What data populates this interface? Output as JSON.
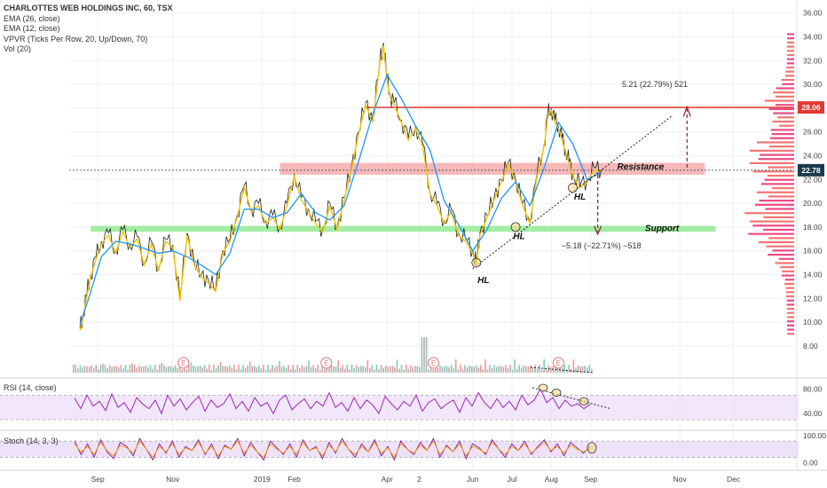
{
  "header": {
    "title": "CHARLOTTES WEB HOLDINGS INC, 60, TSX",
    "indicators": [
      "EMA (26, close)",
      "EMA (12, close)",
      "VPVR (Ticks Per Row, 20, Up/Down, 70)",
      "Vol (20)"
    ]
  },
  "rsi_label": "RSI (14, close)",
  "stoch_label": "Stoch (14, 3, 3)",
  "colors": {
    "price": "#222222",
    "ema_fast": "#f2c400",
    "ema_slow": "#2196f3",
    "resistance_zone": "#f4a7a7",
    "support_zone": "#8fe88f",
    "resistance_line": "#e53935",
    "rsi": "#9c27b0",
    "stoch_k": "#7b1fa2",
    "stoch_d": "#ff9800",
    "panel_band": "#e7d6f7",
    "last_price_bg": "#1b3a4b",
    "resistance_price_bg": "#e53935"
  },
  "chart_data": [
    {
      "type": "line",
      "y_axis_ticks": [
        8,
        10,
        12,
        14,
        16,
        18,
        20,
        22,
        24,
        26,
        28,
        30,
        32,
        34,
        36
      ],
      "y_axis_labels": [
        "8.00",
        "10.00",
        "12.00",
        "14.00",
        "16.00",
        "18.00",
        "20.00",
        "22.00",
        "24.00",
        "26.00",
        "28.00",
        "30.00",
        "32.00",
        "34.00",
        "36.00"
      ],
      "ylim": [
        6.5,
        36.5
      ],
      "x_tick_labels": [
        "Sep",
        "Nov",
        "2019",
        "Feb",
        "Apr",
        "2",
        "Jun",
        "Jul",
        "Aug",
        "Sep",
        "Nov",
        "Dec"
      ],
      "x_tick_pos": [
        0.5,
        2.6,
        5.1,
        6.0,
        8.6,
        9.5,
        11.0,
        12.1,
        13.2,
        14.3,
        16.8,
        18.3
      ],
      "xlim": [
        -0.3,
        20.0
      ],
      "series": [
        {
          "x": [
            0,
            0.1,
            0.2,
            0.3,
            0.45,
            0.6,
            0.8,
            1.0,
            1.2,
            1.4,
            1.6,
            1.8,
            2.0,
            2.2,
            2.4,
            2.6,
            2.8,
            3.0,
            3.2,
            3.4,
            3.6,
            3.8,
            4.0,
            4.2,
            4.4,
            4.6,
            4.8,
            5.0,
            5.2,
            5.4,
            5.6,
            5.8,
            6.0,
            6.2,
            6.4,
            6.6,
            6.8,
            7.0,
            7.2,
            7.4,
            7.6,
            7.8,
            8.0,
            8.2,
            8.4,
            8.5,
            8.6,
            8.7,
            8.8,
            9.0,
            9.2,
            9.4,
            9.6,
            9.8,
            10.0,
            10.2,
            10.4,
            10.6,
            10.8,
            11.0,
            11.1,
            11.2,
            11.4,
            11.6,
            11.8,
            12.0,
            12.2,
            12.4,
            12.6,
            12.8,
            13.0,
            13.1,
            13.2,
            13.3,
            13.4,
            13.5,
            13.6,
            13.7,
            13.8,
            14.0,
            14.2,
            14.4,
            14.6
          ],
          "values": [
            9.5,
            10.8,
            12.5,
            14.0,
            15.5,
            16.8,
            17.5,
            16.0,
            17.8,
            16.5,
            17.2,
            15.0,
            16.8,
            14.5,
            17.0,
            16.5,
            12.0,
            17.5,
            15.0,
            14.0,
            13.5,
            12.8,
            16.0,
            17.0,
            19.0,
            21.5,
            19.5,
            20.0,
            18.5,
            19.0,
            18.0,
            20.0,
            22.5,
            20.5,
            19.5,
            18.5,
            17.8,
            20.0,
            18.0,
            20.5,
            23.0,
            26.0,
            28.5,
            27.0,
            32.0,
            33.5,
            30.5,
            29.0,
            28.5,
            27.0,
            25.5,
            26.5,
            25.0,
            21.0,
            20.0,
            18.5,
            19.5,
            17.5,
            17.0,
            16.0,
            15.0,
            17.5,
            19.0,
            20.5,
            22.0,
            23.5,
            22.0,
            20.0,
            18.5,
            22.5,
            25.0,
            27.5,
            28.0,
            27.0,
            26.5,
            25.5,
            24.5,
            23.5,
            22.5,
            21.5,
            22.0,
            23.0,
            22.78
          ]
        },
        {
          "name": "",
          "x": [
            0,
            0.3,
            0.6,
            1.0,
            1.4,
            1.8,
            2.2,
            2.6,
            3.0,
            3.4,
            3.8,
            4.2,
            4.6,
            5.0,
            5.4,
            5.8,
            6.2,
            6.6,
            7.0,
            7.4,
            7.8,
            8.2,
            8.6,
            9.0,
            9.4,
            9.8,
            10.2,
            10.6,
            11.0,
            11.4,
            11.8,
            12.2,
            12.6,
            13.0,
            13.4,
            13.8,
            14.2,
            14.6
          ],
          "values": [
            9.8,
            12.5,
            15.5,
            16.8,
            16.6,
            16.2,
            15.8,
            16.0,
            15.5,
            14.8,
            14.0,
            15.8,
            19.5,
            19.5,
            18.8,
            19.2,
            20.8,
            19.2,
            18.6,
            19.8,
            23.5,
            27.5,
            30.8,
            28.8,
            26.5,
            24.5,
            20.2,
            18.2,
            16.0,
            17.8,
            20.4,
            21.8,
            19.8,
            23.0,
            26.8,
            25.0,
            22.0,
            22.6
          ]
        }
      ],
      "resistance_price_label": "28.06",
      "last_price_label": "22.78"
    },
    {
      "type": "line",
      "series": [
        {
          "name": "RSI (14, close)",
          "values": [
            65,
            48,
            70,
            52,
            60,
            45,
            72,
            50,
            58,
            42,
            66,
            55,
            48,
            62,
            40,
            70,
            52,
            64,
            46,
            58,
            68,
            44,
            62,
            50,
            56,
            72,
            48,
            60,
            44,
            66,
            52,
            58,
            40,
            62,
            70,
            46,
            56,
            64,
            48,
            60,
            52,
            74,
            50,
            58,
            44,
            66,
            48,
            62,
            54,
            40,
            68,
            56,
            46,
            60,
            52,
            70,
            44,
            58,
            64,
            48,
            56,
            62,
            42,
            66,
            52,
            74,
            58,
            48,
            64,
            50,
            60,
            46,
            70,
            54,
            62,
            80,
            58,
            66,
            48,
            62,
            52,
            56,
            48,
            55
          ]
        }
      ],
      "y_axis_labels": [
        "40.00",
        "80.00"
      ],
      "ylim": [
        20,
        95
      ]
    },
    {
      "type": "line",
      "series": [
        {
          "name": "",
          "values": [
            80,
            30,
            70,
            20,
            85,
            40,
            15,
            75,
            60,
            25,
            90,
            50,
            10,
            70,
            35,
            80,
            20,
            60,
            45,
            85,
            30,
            70,
            15,
            65,
            50,
            90,
            25,
            75,
            40,
            10,
            80,
            55,
            30,
            70,
            20,
            85,
            45,
            60,
            15,
            75,
            35,
            90,
            50,
            20,
            70,
            40,
            85,
            25,
            60,
            10,
            80,
            50,
            30,
            75,
            45,
            90,
            20,
            65,
            40,
            80,
            15,
            70,
            55,
            30,
            85,
            50,
            20,
            70,
            45,
            80,
            30,
            60,
            85,
            40,
            70,
            25,
            75,
            55,
            35,
            60
          ]
        },
        {
          "name": "",
          "values": [
            70,
            40,
            60,
            30,
            75,
            45,
            25,
            65,
            55,
            35,
            80,
            50,
            20,
            60,
            40,
            70,
            30,
            55,
            45,
            75,
            35,
            60,
            25,
            60,
            50,
            80,
            35,
            65,
            40,
            20,
            70,
            50,
            35,
            60,
            30,
            75,
            45,
            55,
            25,
            65,
            40,
            80,
            50,
            30,
            60,
            40,
            75,
            35,
            55,
            20,
            70,
            50,
            35,
            65,
            45,
            80,
            30,
            60,
            40,
            70,
            25,
            60,
            50,
            35,
            75,
            50,
            30,
            60,
            45,
            70,
            35,
            55,
            75,
            45,
            60,
            35,
            65,
            50,
            40,
            55
          ]
        }
      ],
      "y_axis_labels": [
        "0.00",
        "100.00"
      ],
      "ylim": [
        -15,
        110
      ]
    }
  ],
  "annotations": {
    "resistance_label": "Resistance",
    "support_label": "Support",
    "hl_labels": [
      "HL",
      "HL",
      "HL"
    ],
    "up_measure": "5.21 (22.79%) 521",
    "down_measure": "−5.18 (−22.71%) −518",
    "earnings_marker": "E"
  }
}
